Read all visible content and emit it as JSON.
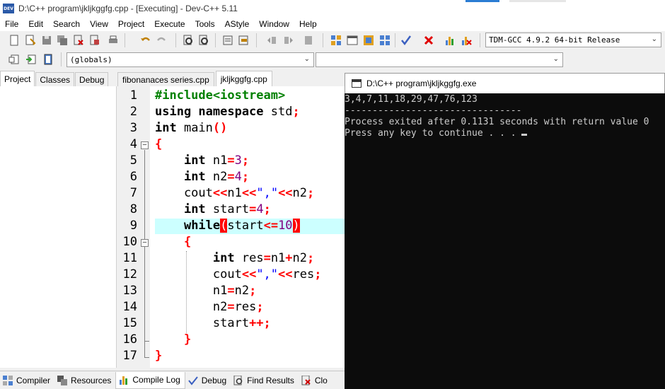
{
  "window": {
    "title": "D:\\C++ program\\jkljkggfg.cpp - [Executing] - Dev-C++ 5.11",
    "app_icon_text": "DEV"
  },
  "menu": [
    "File",
    "Edit",
    "Search",
    "View",
    "Project",
    "Execute",
    "Tools",
    "AStyle",
    "Window",
    "Help"
  ],
  "toolbar": {
    "compiler_select": "TDM-GCC 4.9.2 64-bit Release",
    "scope_select": "(globals)",
    "function_select": ""
  },
  "left_tabs": [
    "Project",
    "Classes",
    "Debug"
  ],
  "editor_tabs": [
    "fibonanaces series.cpp",
    "jkljkggfg.cpp"
  ],
  "editor": {
    "line_numbers": [
      "1",
      "2",
      "3",
      "4",
      "5",
      "6",
      "7",
      "8",
      "9",
      "10",
      "11",
      "12",
      "13",
      "14",
      "15",
      "16",
      "17"
    ],
    "highlighted_line": 9
  },
  "console": {
    "title": "D:\\C++ program\\jkljkggfg.exe",
    "lines": [
      "3,4,7,11,18,29,47,76,123",
      "--------------------------------",
      "Process exited after 0.1131 seconds with return value 0",
      "Press any key to continue . . . "
    ]
  },
  "bottom_tabs": [
    "Compiler",
    "Resources",
    "Compile Log",
    "Debug",
    "Find Results",
    "Clo"
  ],
  "colors": {
    "keyword": "#000000",
    "preprocessor": "#008000",
    "number": "#800080",
    "string": "#0000ff",
    "symbol": "#ff0000",
    "current_line": "#ccffff",
    "console_bg": "#0c0c0c"
  }
}
